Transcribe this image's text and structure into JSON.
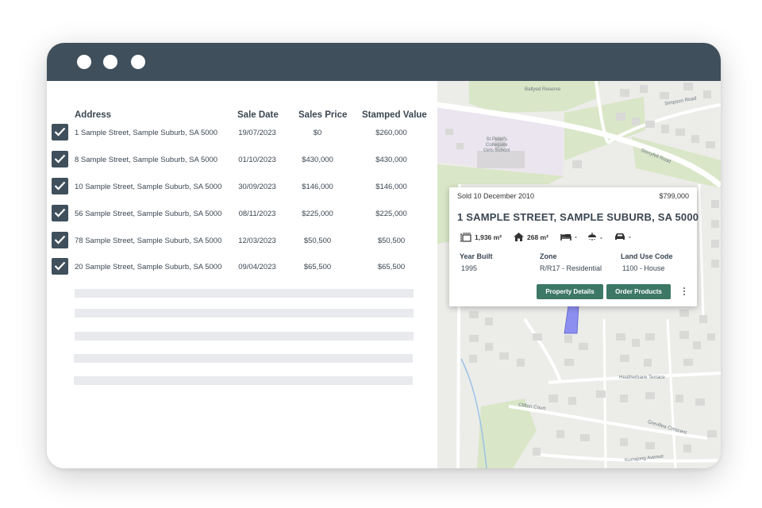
{
  "window": {
    "controls": [
      "window-dot-1",
      "window-dot-2",
      "window-dot-3"
    ]
  },
  "table": {
    "headers": {
      "address": "Address",
      "sale_date": "Sale Date",
      "sales_price": "Sales Price",
      "stamped_value": "Stamped Value"
    },
    "rows": [
      {
        "checked": true,
        "address": "1 Sample Street, Sample Suburb, SA 5000",
        "sale_date": "19/07/2023",
        "sales_price": "$0",
        "stamped_value": "$260,000"
      },
      {
        "checked": true,
        "address": "8 Sample Street, Sample Suburb, SA 5000",
        "sale_date": "01/10/2023",
        "sales_price": "$430,000",
        "stamped_value": "$430,000"
      },
      {
        "checked": true,
        "address": "10 Sample Street, Sample Suburb, SA 5000",
        "sale_date": "30/09/2023",
        "sales_price": "$146,000",
        "stamped_value": "$146,000"
      },
      {
        "checked": true,
        "address": "56 Sample Street, Sample Suburb, SA 5000",
        "sale_date": "08/11/2023",
        "sales_price": "$225,000",
        "stamped_value": "$225,000"
      },
      {
        "checked": true,
        "address": "78 Sample Street, Sample Suburb, SA 5000",
        "sale_date": "12/03/2023",
        "sales_price": "$50,500",
        "stamped_value": "$50,500"
      },
      {
        "checked": true,
        "address": "20 Sample Street, Sample Suburb, SA 5000",
        "sale_date": "09/04/2023",
        "sales_price": "$65,500",
        "stamped_value": "$65,500"
      }
    ]
  },
  "map": {
    "labels": {
      "reserve": "Ballyed Reserve",
      "school": "St Peter's\nCollegiate\nGirls School",
      "simpson_road": "Simpson Road",
      "stonyfell_road": "Stonyfell Road",
      "heatherbank": "Heatherbank Terrace",
      "clifton": "Clifton Court",
      "grevillea": "Grevillea Crescent",
      "kurrajong": "Kurrajong Avenue"
    }
  },
  "property_card": {
    "sold": "Sold 10 December 2010",
    "price": "$799,000",
    "address": "1 SAMPLE STREET, SAMPLE SUBURB, SA 5000",
    "land_area": "1,936 m²",
    "floor_area": "268 m²",
    "bedrooms": "-",
    "bathrooms": "-",
    "car_spaces": "-",
    "year_built_label": "Year Built",
    "year_built": "1995",
    "zone_label": "Zone",
    "zone": "R/R17 - Residential",
    "land_use_label": "Land Use Code",
    "land_use": "1100 - House",
    "details_button": "Property Details",
    "order_button": "Order Products"
  },
  "colors": {
    "titlebar": "#3f4f5c",
    "checkbox": "#3f4f5c",
    "button": "#3d7866",
    "parcel": "#8c8ff0",
    "park": "#d9e6c7",
    "school": "#ebe5ef"
  }
}
